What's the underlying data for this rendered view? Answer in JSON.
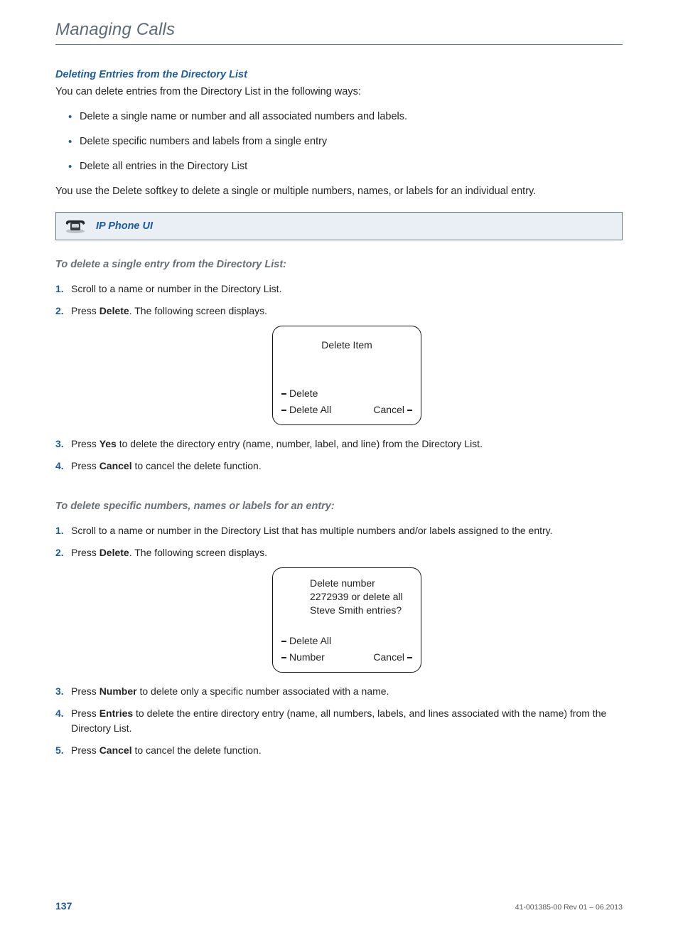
{
  "header": {
    "title": "Managing Calls"
  },
  "section": {
    "heading": "Deleting Entries from the Directory List",
    "intro": "You can delete entries from the Directory List in the following ways:",
    "bullets": [
      "Delete a single name or number and all associated numbers and labels.",
      "Delete specific numbers and labels from a single entry",
      "Delete all entries in the Directory List"
    ],
    "note": "You use the Delete softkey to delete a single or multiple numbers, names, or labels for an individual entry."
  },
  "banner": {
    "label": "IP Phone UI",
    "icon_name": "phone-icon"
  },
  "proc1": {
    "heading": "To delete a single entry from the Directory List:",
    "steps": {
      "s1": "Scroll to a name or number in the Directory List.",
      "s2_pre": "Press ",
      "s2_bold": "Delete",
      "s2_post": ". The following screen displays.",
      "s3_pre": "Press ",
      "s3_bold": "Yes",
      "s3_post": " to delete the directory entry (name, number, label, and line) from the Directory List.",
      "s4_pre": "Press ",
      "s4_bold": "Cancel",
      "s4_post": " to cancel the delete function."
    },
    "screen": {
      "title": "Delete Item",
      "sk_delete": "Delete",
      "sk_delete_all": "Delete All",
      "sk_cancel": "Cancel"
    }
  },
  "proc2": {
    "heading": "To delete specific numbers, names or labels for an entry:",
    "steps": {
      "s1": "Scroll to a name or number in the Directory List that has multiple numbers and/or labels assigned to the entry.",
      "s2_pre": "Press ",
      "s2_bold": "Delete",
      "s2_post": ". The following screen displays.",
      "s3_pre": "Press ",
      "s3_bold": "Number",
      "s3_post": " to delete only a specific number associated with a name.",
      "s4_pre": "Press ",
      "s4_bold": "Entries",
      "s4_post": " to delete the entire directory entry (name, all numbers, labels, and lines associated with the name) from the Directory List.",
      "s5_pre": "Press ",
      "s5_bold": "Cancel",
      "s5_post": " to cancel the delete function."
    },
    "screen": {
      "msg": "Delete number 2272939 or delete all Steve Smith entries?",
      "sk_delete_all": "Delete All",
      "sk_number": "Number",
      "sk_cancel": "Cancel"
    }
  },
  "footer": {
    "page": "137",
    "rev": "41-001385-00 Rev 01 – 06.2013"
  }
}
